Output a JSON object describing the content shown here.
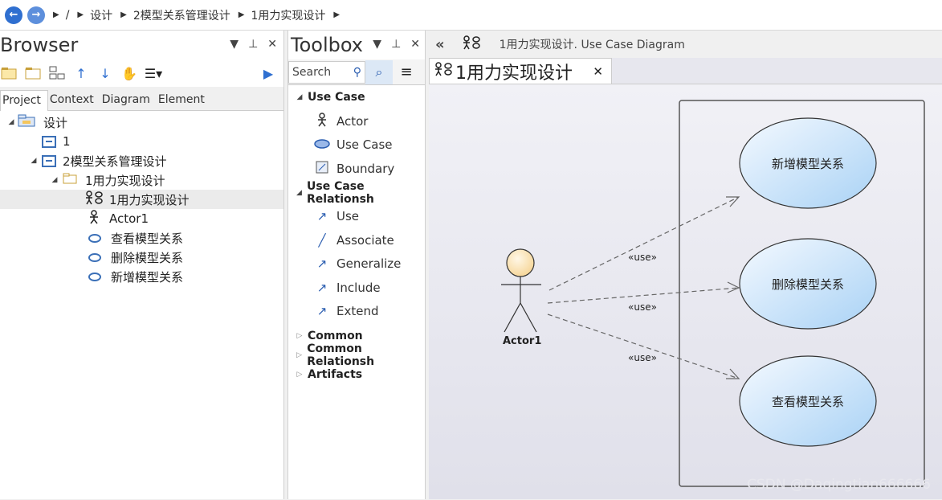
{
  "nav": {
    "root": "/",
    "crumbs": [
      "设计",
      "2模型关系管理设计",
      "1用力实现设计"
    ]
  },
  "browser": {
    "title": "Browser",
    "tabs": [
      "Project",
      "Context",
      "Diagram",
      "Element"
    ],
    "tree": [
      {
        "label": "设计",
        "icon": "package-icon"
      },
      {
        "label": "1",
        "icon": "model-icon"
      },
      {
        "label": "2模型关系管理设计",
        "icon": "model-icon"
      },
      {
        "label": "1用力实现设计",
        "icon": "folder-icon"
      },
      {
        "label": "1用力实现设计",
        "icon": "use-case-diagram-icon"
      },
      {
        "label": "Actor1",
        "icon": "actor-icon"
      },
      {
        "label": "查看模型关系",
        "icon": "use-case-icon"
      },
      {
        "label": "删除模型关系",
        "icon": "use-case-icon"
      },
      {
        "label": "新增模型关系",
        "icon": "use-case-icon"
      }
    ]
  },
  "toolbox": {
    "title": "Toolbox",
    "search_label": "Search",
    "group_use_case": "Use Case",
    "use_case_items": [
      "Actor",
      "Use Case",
      "Boundary"
    ],
    "group_relationships": "Use Case Relationsh",
    "relationship_items": [
      "Use",
      "Associate",
      "Generalize",
      "Include",
      "Extend"
    ],
    "collapsed_groups": [
      "Common",
      "Common Relationsh",
      "Artifacts"
    ]
  },
  "diagram": {
    "header_label": "1用力实现设计.  Use Case Diagram",
    "tab_label": "1用力实现设计",
    "actor": "Actor1",
    "use_cases": [
      "新增模型关系",
      "删除模型关系",
      "查看模型关系"
    ],
    "connector_label": "«use»",
    "watermark": "CSDN @Daqingtian666666"
  },
  "colors": {
    "accent": "#2f6fd0",
    "use_case_fill": "#d8ecfb",
    "actor_head": "#fde4b5"
  }
}
